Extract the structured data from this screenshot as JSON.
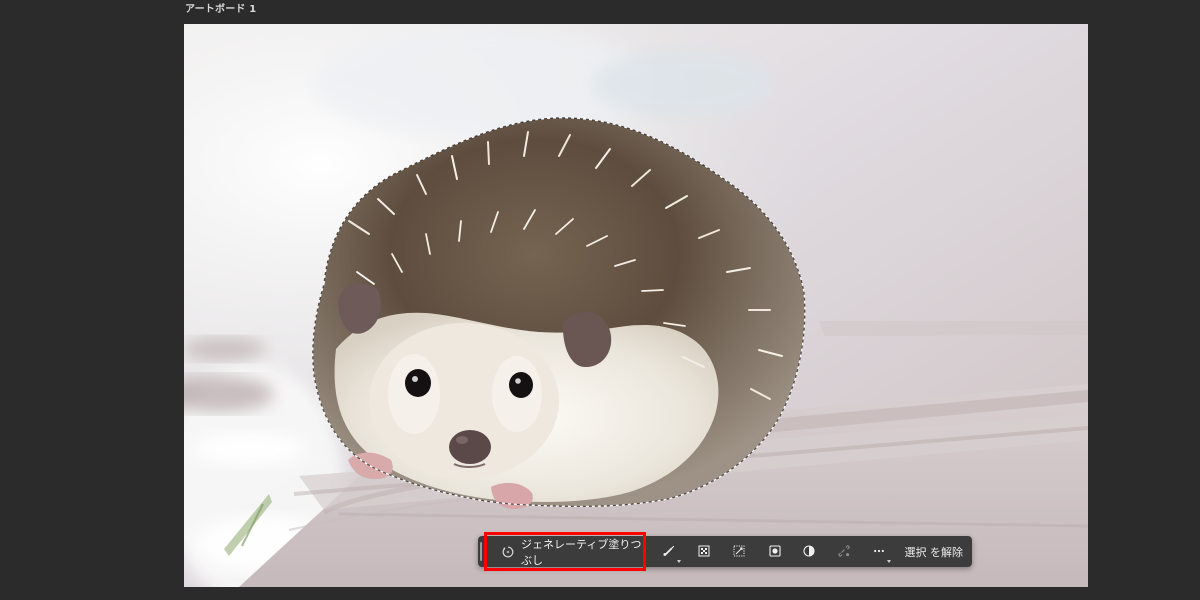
{
  "artboard": {
    "title": "アートボード 1"
  },
  "canvas": {
    "subject_label": "hedgehog photo"
  },
  "toolbar": {
    "generative_fill_label": "ジェネレーティブ塗りつぶし",
    "deselect_label": "選択 を解除",
    "icons": [
      "brush-icon",
      "mask-icon",
      "transform-icon",
      "fill-icon",
      "adjustment-icon",
      "link-icon",
      "more-icon"
    ]
  },
  "colors": {
    "app_background": "#2b2b2b",
    "toolbar_background": "#363636",
    "highlight": "#ff0000"
  }
}
